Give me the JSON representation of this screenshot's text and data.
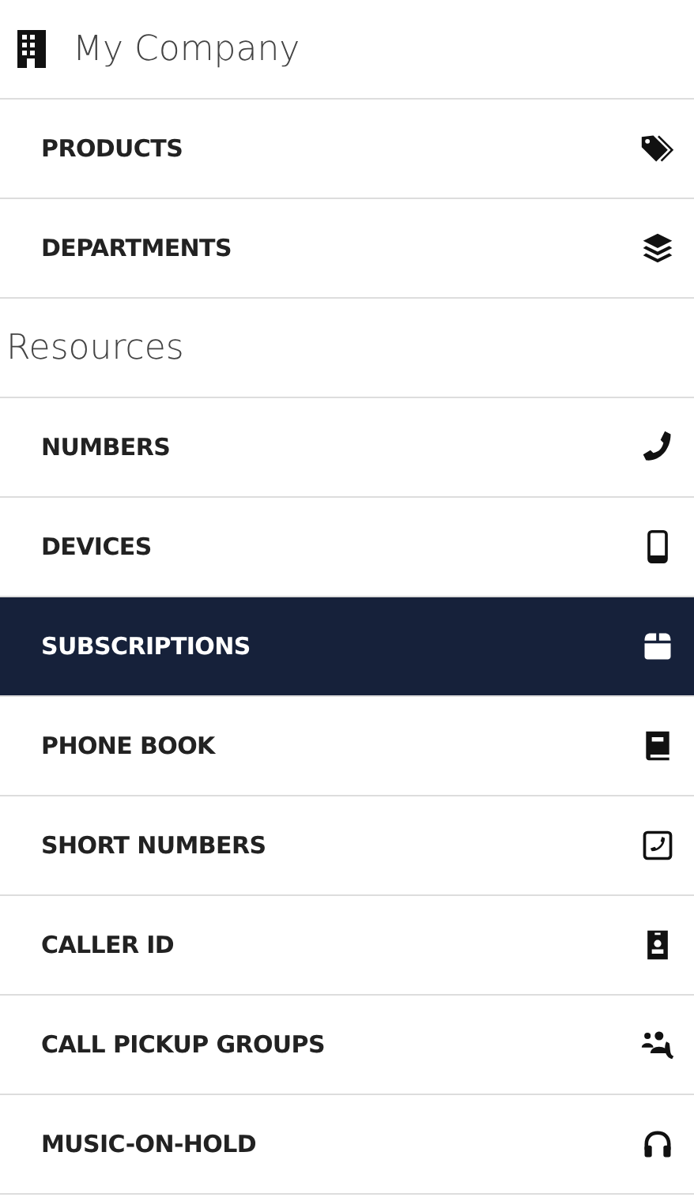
{
  "sections": [
    {
      "title": "My Company",
      "items": [
        {
          "label": "PRODUCTS",
          "kind": "tags",
          "selected": false
        },
        {
          "label": "DEPARTMENTS",
          "kind": "layers",
          "selected": false
        }
      ]
    },
    {
      "title": "Resources",
      "items": [
        {
          "label": "NUMBERS",
          "kind": "phone",
          "selected": false
        },
        {
          "label": "DEVICES",
          "kind": "mobile",
          "selected": false
        },
        {
          "label": "SUBSCRIPTIONS",
          "kind": "box",
          "selected": true
        },
        {
          "label": "PHONE BOOK",
          "kind": "book",
          "selected": false
        },
        {
          "label": "SHORT NUMBERS",
          "kind": "phone-square",
          "selected": false
        },
        {
          "label": "CALLER ID",
          "kind": "id-badge",
          "selected": false
        },
        {
          "label": "CALL PICKUP GROUPS",
          "kind": "users-phone",
          "selected": false
        },
        {
          "label": "MUSIC-ON-HOLD",
          "kind": "headphones",
          "selected": false
        }
      ]
    }
  ]
}
